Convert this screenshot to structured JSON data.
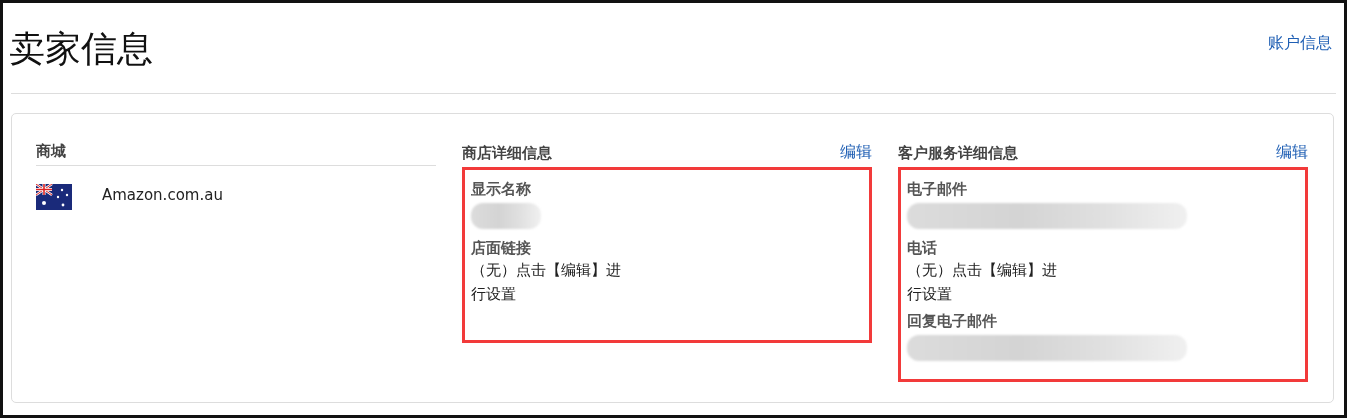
{
  "page": {
    "title": "卖家信息",
    "account_link": "账户信息"
  },
  "marketplace": {
    "heading": "商城",
    "rows": [
      {
        "name": "Amazon.com.au"
      }
    ]
  },
  "sections": [
    {
      "heading": "商店详细信息",
      "edit": "编辑",
      "highlighted": true,
      "fields": [
        {
          "label": "显示名称",
          "kind": "redacted",
          "short": true
        },
        {
          "label": "店面链接",
          "kind": "text",
          "value": "（无）点击【编辑】进行设置"
        }
      ]
    },
    {
      "heading": "客户服务详细信息",
      "edit": "编辑",
      "highlighted": true,
      "fields": [
        {
          "label": "电子邮件",
          "kind": "redacted",
          "short": false
        },
        {
          "label": "电话",
          "kind": "text",
          "value": "（无）点击【编辑】进行设置"
        },
        {
          "label": "回复电子邮件",
          "kind": "redacted",
          "short": false
        }
      ]
    }
  ]
}
